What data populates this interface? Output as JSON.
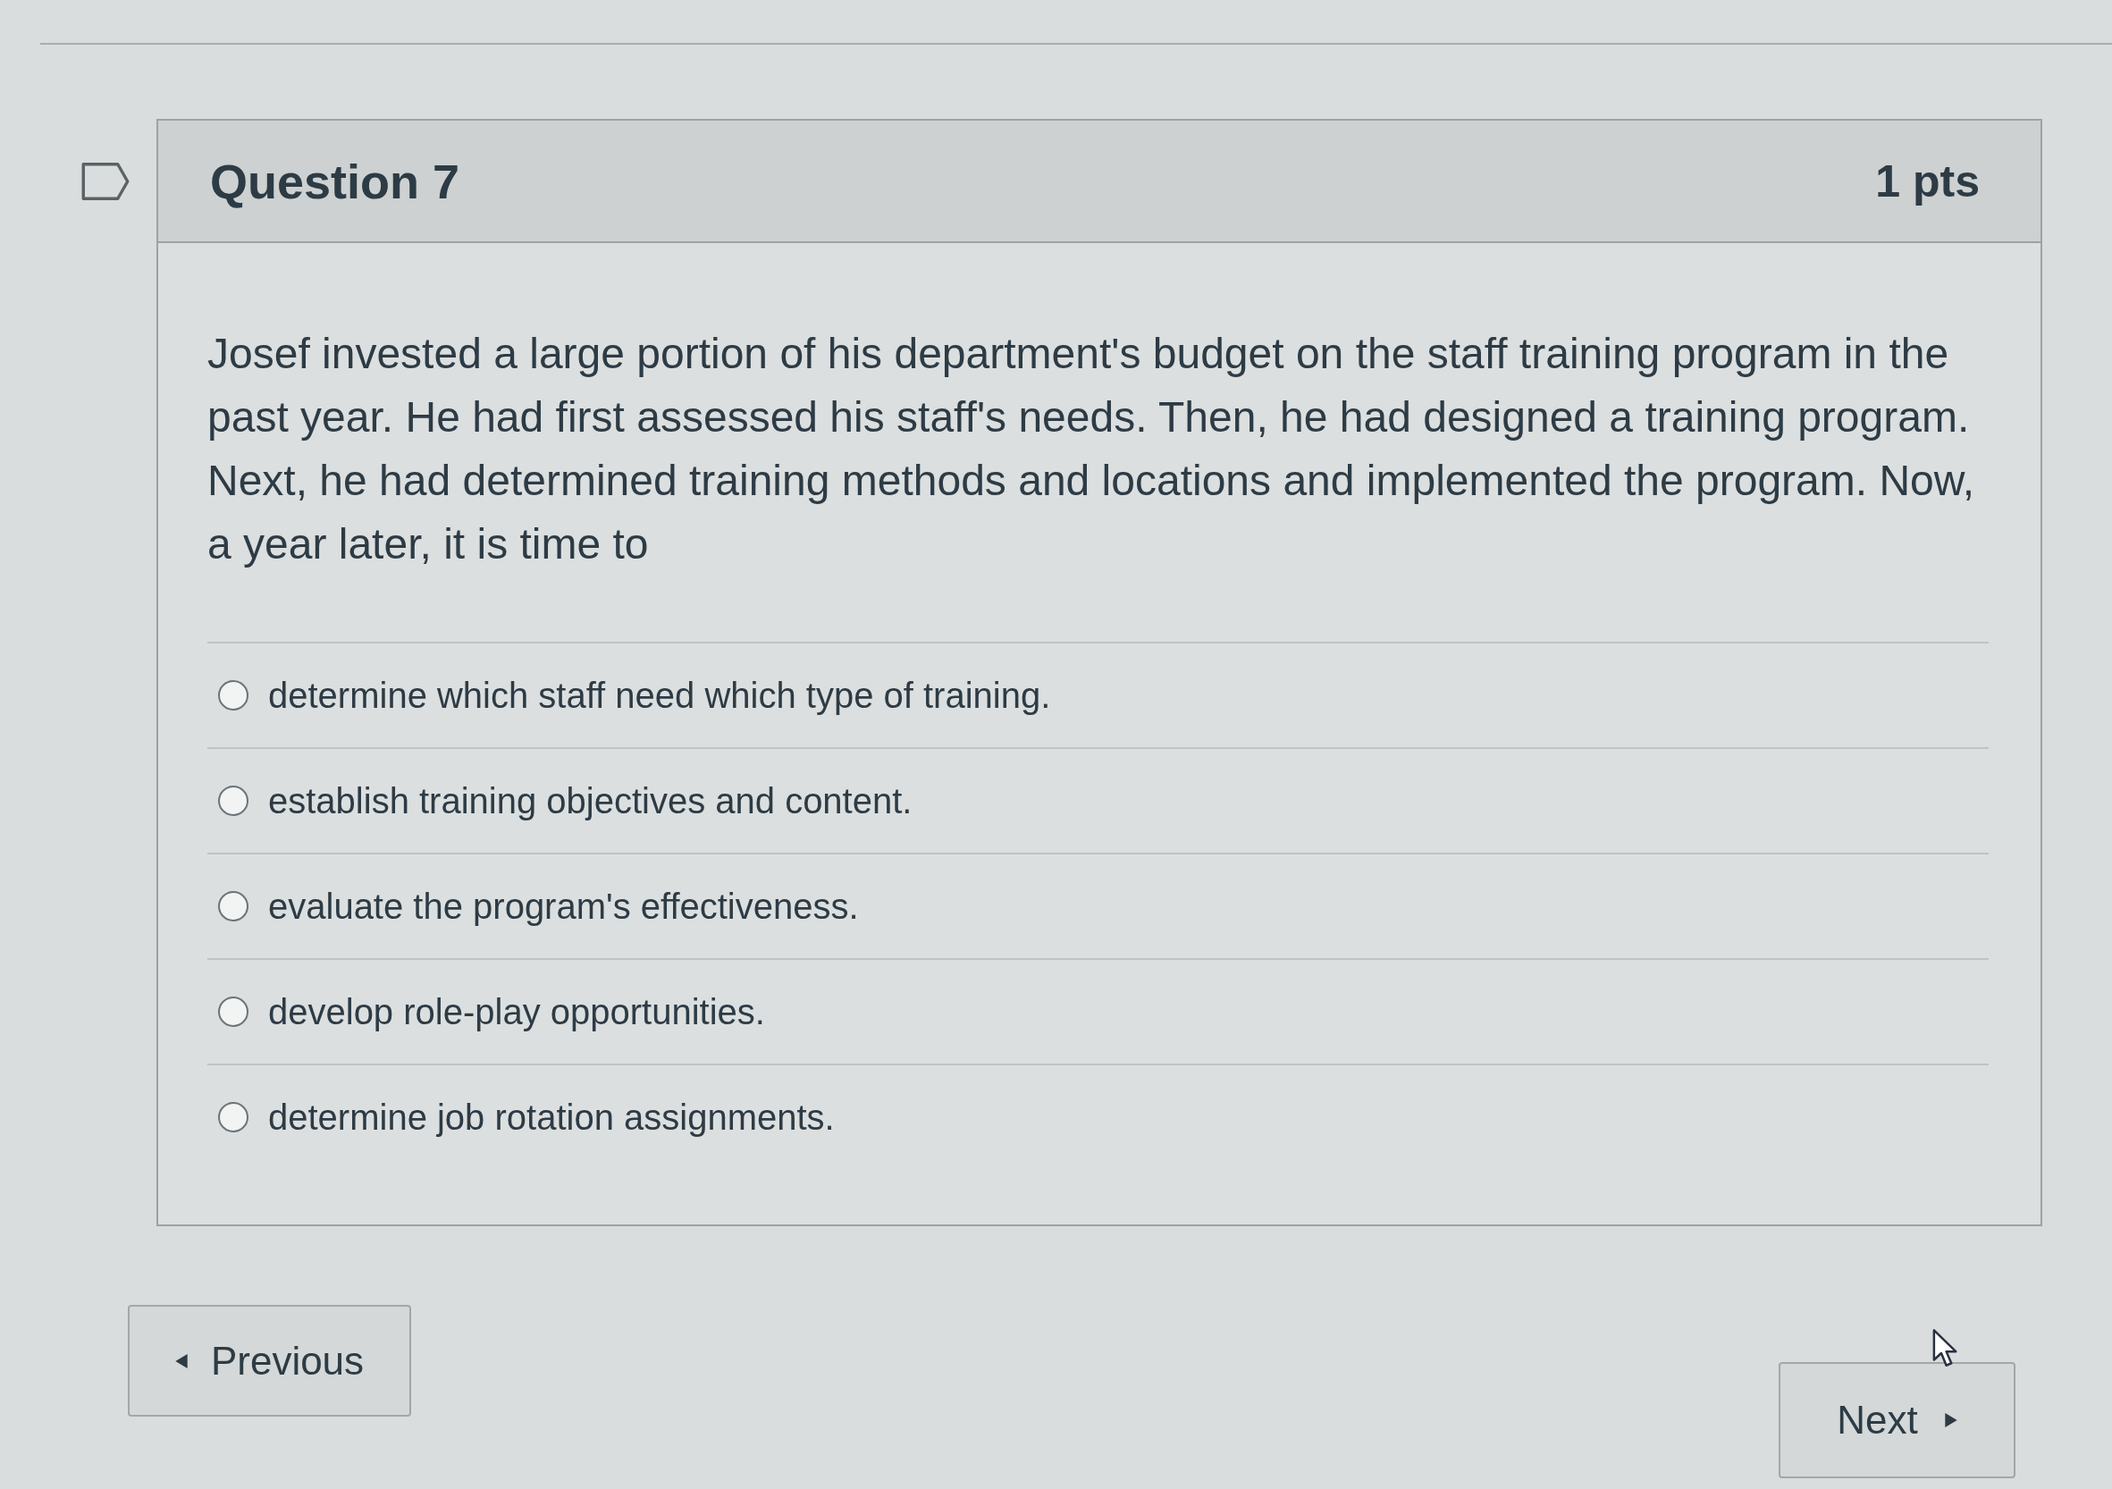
{
  "question": {
    "flagged": false,
    "title": "Question 7",
    "points": "1 pts",
    "text": "Josef invested a large portion of his department's budget on the staff training program in the past year. He had first assessed his staff's needs. Then, he had designed a training program. Next, he had determined training methods and locations and implemented the program. Now, a year later, it is time to"
  },
  "answers": [
    {
      "label": "determine which staff need which type of training.",
      "selected": false
    },
    {
      "label": "establish training objectives and content.",
      "selected": false
    },
    {
      "label": "evaluate the program's effectiveness.",
      "selected": false
    },
    {
      "label": "develop role-play opportunities.",
      "selected": false
    },
    {
      "label": "determine job rotation assignments.",
      "selected": false
    }
  ],
  "navigation": {
    "previous": {
      "label": "Previous"
    },
    "next": {
      "label": "Next"
    }
  }
}
